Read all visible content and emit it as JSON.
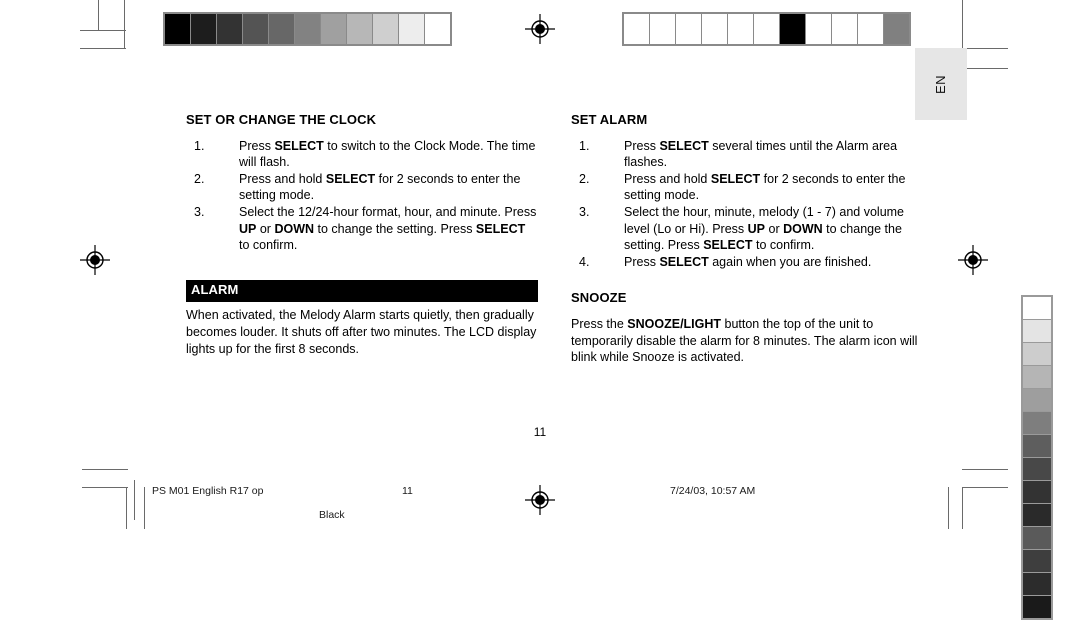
{
  "document": {
    "language_tab": "EN",
    "page_number": "11"
  },
  "left_column": {
    "section_clock": {
      "title": "SET OR CHANGE THE CLOCK",
      "steps": [
        {
          "num": "1.",
          "html": "Press <b>SELECT</b> to switch to the Clock Mode. The time will flash."
        },
        {
          "num": "2.",
          "html": "Press and hold <b>SELECT</b> for 2 seconds to enter the setting mode."
        },
        {
          "num": "3.",
          "html": "Select the 12/24-hour format, hour, and minute. Press <b>UP</b> or <b>DOWN</b> to change the setting. Press <b>SELECT</b> to confirm."
        }
      ]
    },
    "section_alarm": {
      "title": "ALARM",
      "body_html": "When activated, the Melody Alarm starts quietly, then gradually becomes louder. It shuts off after two minutes. The LCD display lights up for the first 8 seconds."
    }
  },
  "right_column": {
    "section_set_alarm": {
      "title": "SET ALARM",
      "steps": [
        {
          "num": "1.",
          "html": "Press <b>SELECT</b> several times until the Alarm area flashes."
        },
        {
          "num": "2.",
          "html": "Press and hold <b>SELECT</b> for 2 seconds to enter the setting mode."
        },
        {
          "num": "3.",
          "html": "Select the hour, minute, melody (1 - 7) and volume level (Lo or Hi). Press <b>UP</b> or <b>DOWN</b> to change the setting. Press <b>SELECT</b> to confirm."
        },
        {
          "num": "4.",
          "html": "Press <b>SELECT</b> again when you are finished."
        }
      ]
    },
    "section_snooze": {
      "title": "SNOOZE",
      "body_html": "Press the <b>SNOOZE/LIGHT</b> button the top of the unit to temporarily disable the alarm for 8 minutes. The alarm icon will blink while Snooze is activated."
    }
  },
  "footer": {
    "job_name": "PS M01 English R17 op",
    "page": "11",
    "plate": "Black",
    "timestamp": "7/24/03, 10:57 AM"
  },
  "print_marks": {
    "top_left_bar": {
      "name": "grayscale-step-wedge",
      "swatches": [
        "#000000",
        "#1d1d1d",
        "#333333",
        "#545454",
        "#676767",
        "#828282",
        "#a0a0a0",
        "#b7b7b7",
        "#cfcfcf",
        "#ededed",
        "#ffffff"
      ]
    },
    "top_right_bar": {
      "name": "registration-patch-bar",
      "swatches": [
        "#ffffff",
        "#ffffff",
        "#ffffff",
        "#ffffff",
        "#ffffff",
        "#ffffff",
        "#000000",
        "#ffffff",
        "#ffffff",
        "#ffffff",
        "#808080"
      ]
    },
    "right_vertical_bar": {
      "name": "grayscale-step-wedge-vertical",
      "swatches": [
        "#ffffff",
        "#e4e4e4",
        "#cdcdcd",
        "#b5b5b5",
        "#9e9e9e",
        "#7e7e7e",
        "#5e5e5e",
        "#484848",
        "#333333",
        "#2a2a2a",
        "#5a5a5a",
        "#3e3e3e",
        "#2c2c2c",
        "#1a1a1a"
      ]
    }
  }
}
